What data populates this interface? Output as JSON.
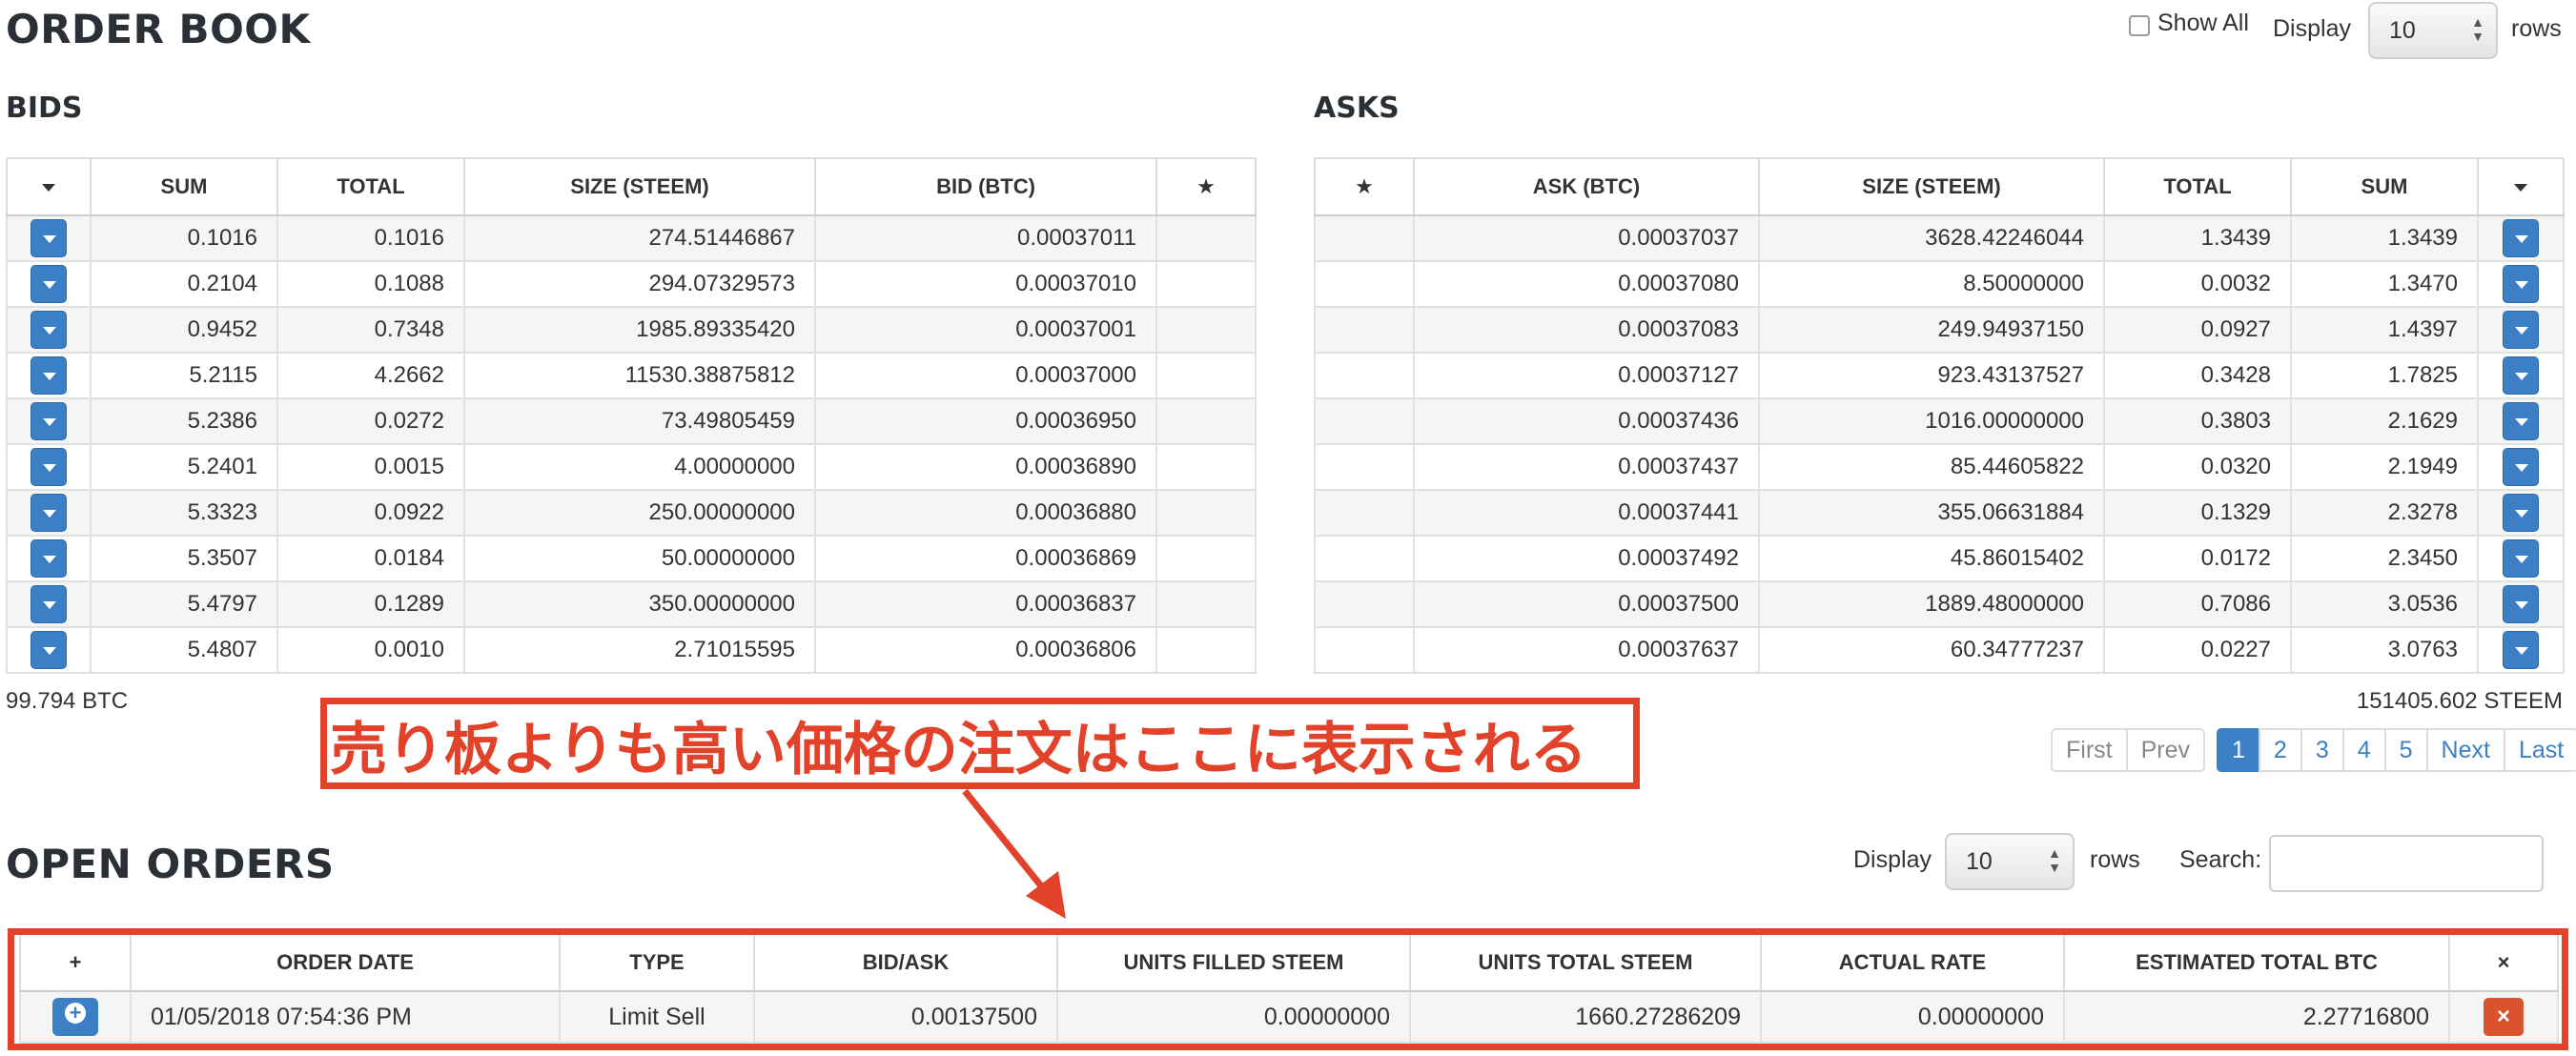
{
  "order_book": {
    "title": "ORDER BOOK",
    "show_all_label": "Show All",
    "display_label": "Display",
    "display_value": "10",
    "rows_label": "rows"
  },
  "bids": {
    "title": "BIDS",
    "columns": [
      "SUM",
      "TOTAL",
      "SIZE (STEEM)",
      "BID (BTC)"
    ],
    "rows": [
      [
        "0.1016",
        "0.1016",
        "274.51446867",
        "0.00037011"
      ],
      [
        "0.2104",
        "0.1088",
        "294.07329573",
        "0.00037010"
      ],
      [
        "0.9452",
        "0.7348",
        "1985.89335420",
        "0.00037001"
      ],
      [
        "5.2115",
        "4.2662",
        "11530.38875812",
        "0.00037000"
      ],
      [
        "5.2386",
        "0.0272",
        "73.49805459",
        "0.00036950"
      ],
      [
        "5.2401",
        "0.0015",
        "4.00000000",
        "0.00036890"
      ],
      [
        "5.3323",
        "0.0922",
        "250.00000000",
        "0.00036880"
      ],
      [
        "5.3507",
        "0.0184",
        "50.00000000",
        "0.00036869"
      ],
      [
        "5.4797",
        "0.1289",
        "350.00000000",
        "0.00036837"
      ],
      [
        "5.4807",
        "0.0010",
        "2.71015595",
        "0.00036806"
      ]
    ],
    "total": "99.794 BTC"
  },
  "asks": {
    "title": "ASKS",
    "columns": [
      "ASK (BTC)",
      "SIZE (STEEM)",
      "TOTAL",
      "SUM"
    ],
    "rows": [
      [
        "0.00037037",
        "3628.42246044",
        "1.3439",
        "1.3439"
      ],
      [
        "0.00037080",
        "8.50000000",
        "0.0032",
        "1.3470"
      ],
      [
        "0.00037083",
        "249.94937150",
        "0.0927",
        "1.4397"
      ],
      [
        "0.00037127",
        "923.43137527",
        "0.3428",
        "1.7825"
      ],
      [
        "0.00037436",
        "1016.00000000",
        "0.3803",
        "2.1629"
      ],
      [
        "0.00037437",
        "85.44605822",
        "0.0320",
        "2.1949"
      ],
      [
        "0.00037441",
        "355.06631884",
        "0.1329",
        "2.3278"
      ],
      [
        "0.00037492",
        "45.86015402",
        "0.0172",
        "2.3450"
      ],
      [
        "0.00037500",
        "1889.48000000",
        "0.7086",
        "3.0536"
      ],
      [
        "0.00037637",
        "60.34777237",
        "0.0227",
        "3.0763"
      ]
    ],
    "total": "151405.602 STEEM"
  },
  "pagination": {
    "first": "First",
    "prev": "Prev",
    "pages": [
      "1",
      "2",
      "3",
      "4",
      "5"
    ],
    "active_page": "1",
    "next": "Next",
    "last": "Last"
  },
  "annotation": {
    "text": "売り板よりも高い価格の注文はここに表示される"
  },
  "open_orders": {
    "title": "OPEN ORDERS",
    "display_label": "Display",
    "display_value": "10",
    "rows_label": "rows",
    "search_label": "Search:",
    "search_value": "",
    "add_symbol": "+",
    "remove_symbol": "×",
    "columns": [
      "ORDER DATE",
      "TYPE",
      "BID/ASK",
      "UNITS FILLED STEEM",
      "UNITS TOTAL STEEM",
      "ACTUAL RATE",
      "ESTIMATED TOTAL BTC"
    ],
    "rows": [
      [
        "01/05/2018 07:54:36 PM",
        "Limit Sell",
        "0.00137500",
        "0.00000000",
        "1660.27286209",
        "0.00000000",
        "2.27716800"
      ]
    ]
  },
  "colors": {
    "accent_blue": "#3b7fc4",
    "annotation_red": "#e2412a",
    "cancel_orange": "#d9542e"
  },
  "icons": {
    "row_dropdown": "caret-down-button-icon",
    "favorite": "star-icon",
    "add_order": "plus-circle-icon",
    "cancel_order": "close-icon"
  }
}
